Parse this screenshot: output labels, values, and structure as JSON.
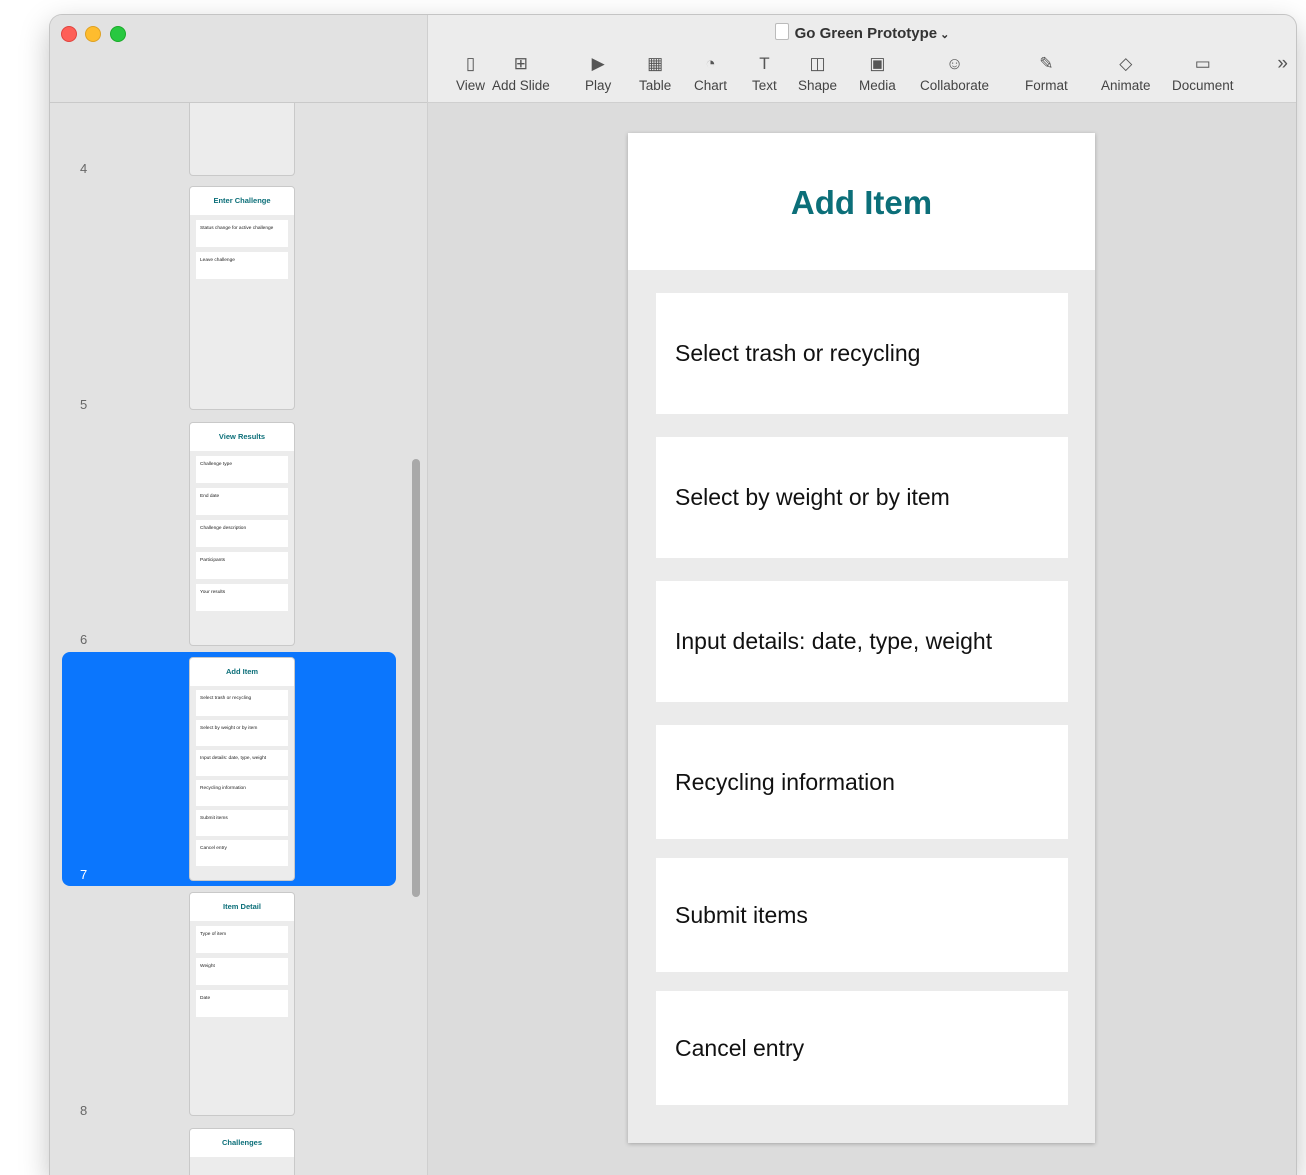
{
  "window": {
    "doc_title": "Go Green Prototype"
  },
  "toolbar": [
    {
      "id": "view",
      "label": "View",
      "icon": "sidebar-icon"
    },
    {
      "id": "add-slide",
      "label": "Add Slide",
      "icon": "plus-square-icon"
    },
    {
      "id": "play",
      "label": "Play",
      "icon": "play-icon"
    },
    {
      "id": "table",
      "label": "Table",
      "icon": "table-icon"
    },
    {
      "id": "chart",
      "label": "Chart",
      "icon": "chart-icon"
    },
    {
      "id": "text",
      "label": "Text",
      "icon": "text-box-icon"
    },
    {
      "id": "shape",
      "label": "Shape",
      "icon": "shape-icon"
    },
    {
      "id": "media",
      "label": "Media",
      "icon": "photo-icon"
    },
    {
      "id": "collaborate",
      "label": "Collaborate",
      "icon": "collaborate-icon"
    },
    {
      "id": "format",
      "label": "Format",
      "icon": "paintbrush-icon"
    },
    {
      "id": "animate",
      "label": "Animate",
      "icon": "diamond-icon"
    },
    {
      "id": "document",
      "label": "Document",
      "icon": "document-icon"
    }
  ],
  "sidebar": {
    "slides": [
      {
        "num": "4",
        "title": "",
        "rows": [],
        "selected": false
      },
      {
        "num": "5",
        "title": "Enter Challenge",
        "rows": [
          "Status change for active challenge",
          "Leave challenge"
        ],
        "selected": false
      },
      {
        "num": "6",
        "title": "View Results",
        "rows": [
          "Challenge type",
          "End date",
          "Challenge description",
          "Participants",
          "Your results"
        ],
        "selected": false
      },
      {
        "num": "7",
        "title": "Add Item",
        "rows": [
          "Select trash or recycling",
          "Select by weight or by item",
          "Input details: date, type, weight",
          "Recycling information",
          "Submit items",
          "Cancel entry"
        ],
        "selected": true
      },
      {
        "num": "8",
        "title": "Item Detail",
        "rows": [
          "Type of item",
          "Weight",
          "Date"
        ],
        "selected": false
      },
      {
        "num": "",
        "title": "Challenges",
        "rows": [],
        "selected": false
      }
    ]
  },
  "slide": {
    "title": "Add Item",
    "items": [
      "Select trash or recycling",
      "Select by weight or by item",
      "Input details: date, type, weight",
      "Recycling information",
      "Submit items",
      "Cancel entry"
    ]
  }
}
